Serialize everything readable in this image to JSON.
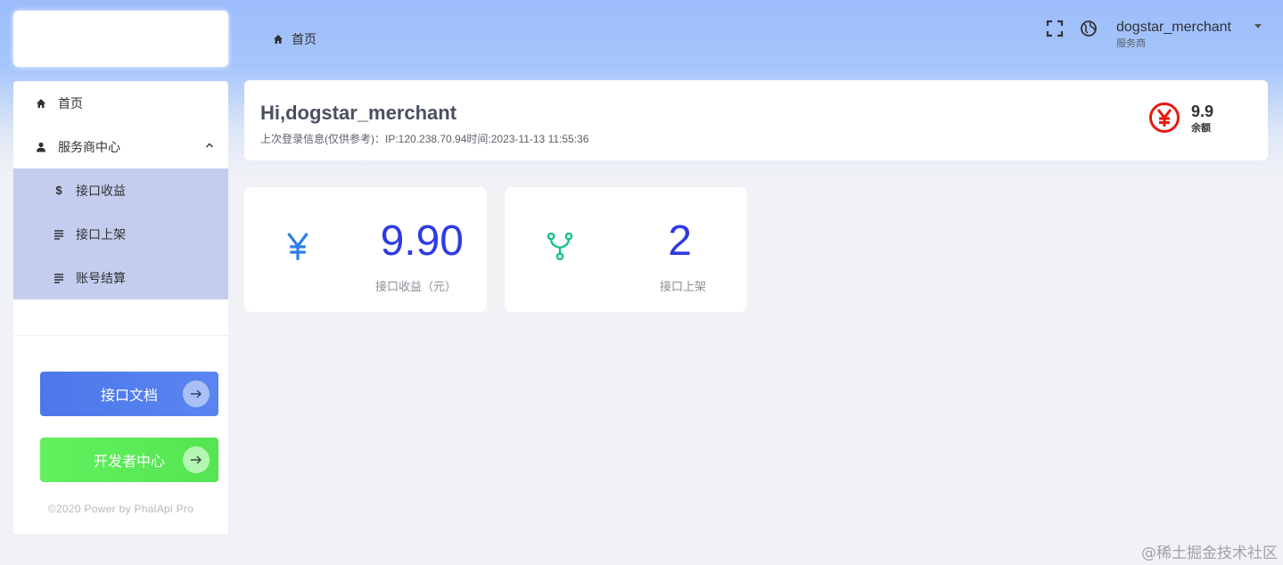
{
  "breadcrumb": {
    "home_label": "首页"
  },
  "header": {
    "username": "dogstar_merchant",
    "role": "服务商"
  },
  "sidebar": {
    "items": [
      {
        "label": "首页"
      },
      {
        "label": "服务商中心"
      }
    ],
    "subitems": [
      {
        "label": "接口收益"
      },
      {
        "label": "接口上架"
      },
      {
        "label": "账号结算"
      }
    ],
    "buttons": {
      "doc_label": "接口文档",
      "dev_label": "开发者中心"
    },
    "copyright": "©2020 Power by PhalApi Pro"
  },
  "welcome": {
    "title": "Hi,dogstar_merchant",
    "login_info": "上次登录信息(仅供参考)：IP:120.238.70.94时间:2023-11-13 11:55:36",
    "balance_value": "9.9",
    "balance_label": "余额"
  },
  "stats": [
    {
      "value": "9.90",
      "label": "接口收益（元）",
      "icon": "yen-icon"
    },
    {
      "value": "2",
      "label": "接口上架",
      "icon": "fork-icon"
    }
  ],
  "colors": {
    "accent": "#2e3be3",
    "submenu_bg": "#c4cdee",
    "doc_button": "#4c78ea",
    "dev_button": "#5ee95a",
    "balance_icon": "#e8190f",
    "fork_icon": "#12c286"
  },
  "watermark": "@稀土掘金技术社区"
}
